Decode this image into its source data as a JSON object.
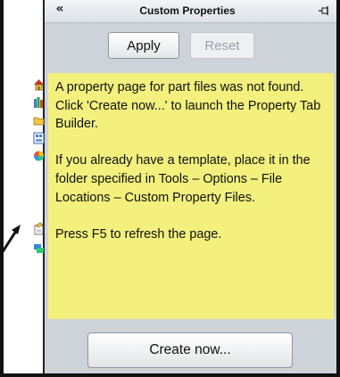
{
  "panel": {
    "title": "Custom Properties",
    "collapse_label": "«",
    "apply_label": "Apply",
    "reset_label": "Reset",
    "message_paragraphs": [
      "A property page for part files was not found. Click 'Create now...' to launch the Property Tab Builder.",
      "If you already have a template, place it in the folder specified in Tools – Options – File Locations – Custom Property Files.",
      "Press F5 to refresh the page."
    ],
    "create_label": "Create now..."
  },
  "colors": {
    "note_background": "#f3f07e",
    "panel_background": "#ced3d9"
  },
  "taskpane_tabs": [
    {
      "icon": "home-icon"
    },
    {
      "icon": "design-library-icon"
    },
    {
      "icon": "file-explorer-folder-icon"
    },
    {
      "icon": "view-palette-icon"
    },
    {
      "icon": "appearances-icon"
    },
    {
      "icon": "custom-properties-icon"
    },
    {
      "icon": "forum-icon"
    }
  ]
}
